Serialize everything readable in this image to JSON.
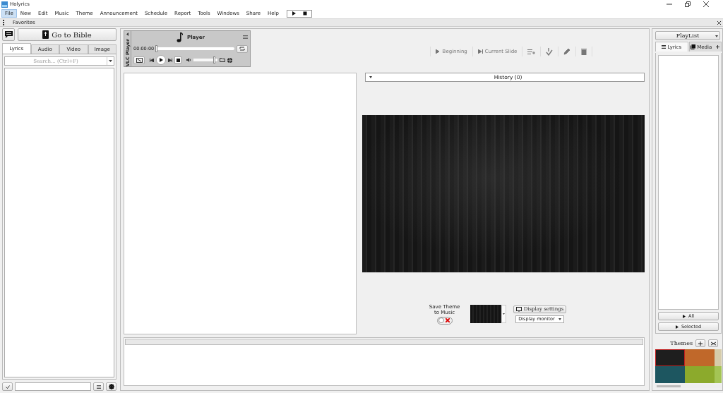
{
  "window": {
    "title": "Holyrics"
  },
  "menu": [
    {
      "label": "File",
      "selected": true
    },
    {
      "label": "New",
      "selected": false
    },
    {
      "label": "Edit",
      "selected": false
    },
    {
      "label": "Music",
      "selected": false
    },
    {
      "label": "Theme",
      "selected": false
    },
    {
      "label": "Announcement",
      "selected": false
    },
    {
      "label": "Schedule",
      "selected": false
    },
    {
      "label": "Report",
      "selected": false
    },
    {
      "label": "Tools",
      "selected": false
    },
    {
      "label": "Windows",
      "selected": false
    },
    {
      "label": "Share",
      "selected": false
    },
    {
      "label": "Help",
      "selected": false
    }
  ],
  "favorites": {
    "label": "Favorites"
  },
  "left": {
    "bible_button": "Go to Bible",
    "tabs": [
      {
        "label": "Lyrics",
        "selected": true
      },
      {
        "label": "Audio",
        "selected": false
      },
      {
        "label": "Video",
        "selected": false
      },
      {
        "label": "Image",
        "selected": false
      }
    ],
    "search": {
      "placeholder": "Search... (Ctrl+F)"
    }
  },
  "player": {
    "side_label": "VLC Player",
    "title": "Player",
    "time": "00:00:00",
    "progress": {
      "level": 0.0
    },
    "volume": {
      "level": 0.85
    }
  },
  "toolbar": [
    {
      "kind": "text",
      "label": "Beginning",
      "disabled": true
    },
    {
      "kind": "text",
      "label": "Current Slide",
      "disabled": true
    },
    {
      "kind": "icon",
      "disabled": true
    },
    {
      "kind": "icon",
      "disabled": true
    },
    {
      "kind": "icon",
      "disabled": true
    },
    {
      "kind": "icon",
      "disabled": true
    }
  ],
  "history": {
    "label": "History (0)"
  },
  "save_theme": {
    "label": "Save Theme to Music",
    "on": false
  },
  "display": {
    "settings_button": "Display settings",
    "select_value": "Display monitor"
  },
  "right": {
    "playlist": "PlayList",
    "tabs": [
      {
        "label": "Lyrics",
        "selected": true
      },
      {
        "label": "Media",
        "selected": false
      }
    ],
    "all_button": "All",
    "selected_button": "Selected",
    "themes_label": "Themes",
    "themes": [
      {
        "color": "#1e1e1e",
        "selected": true
      },
      {
        "color": "#c0682a",
        "selected": false
      },
      {
        "color": "#d6ccaa",
        "selected": false
      },
      {
        "color": "#1d5660",
        "selected": false
      },
      {
        "color": "#8caa2c",
        "selected": false
      },
      {
        "color": "#a4c454",
        "selected": false
      }
    ]
  }
}
